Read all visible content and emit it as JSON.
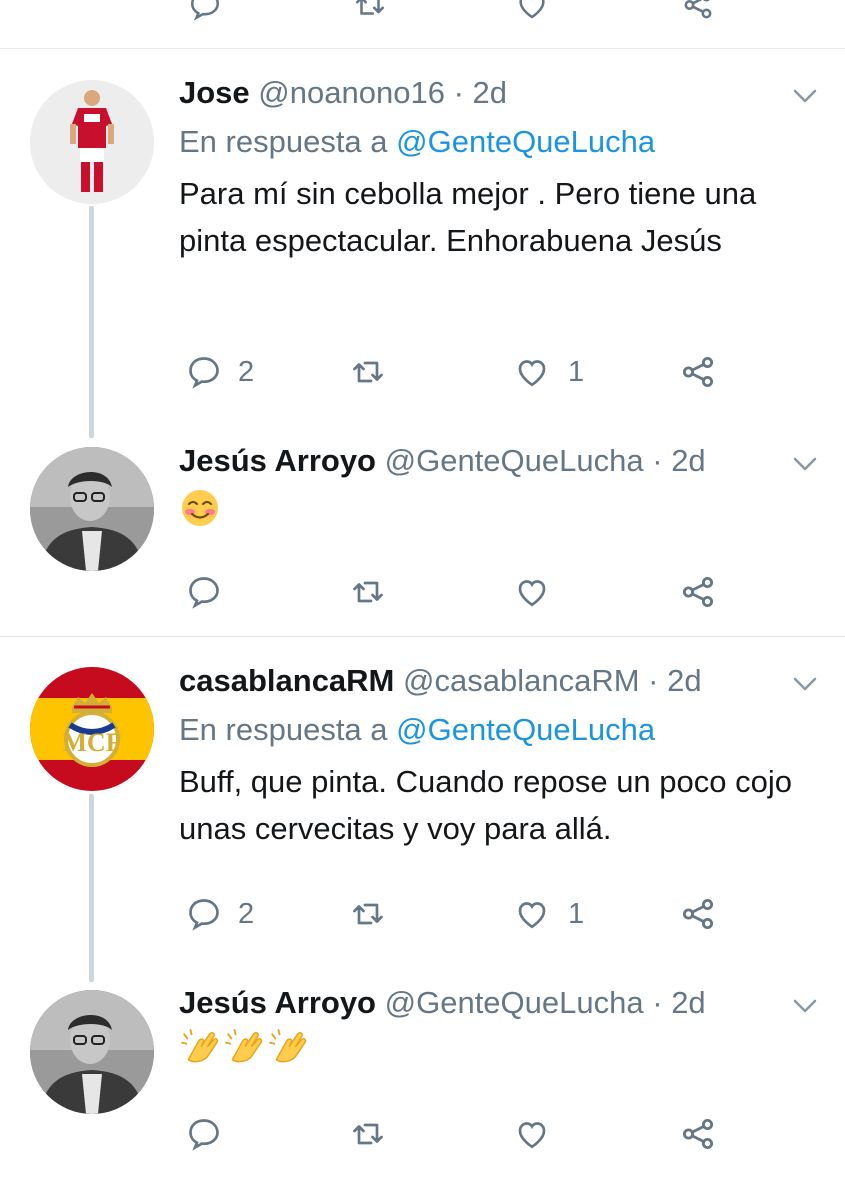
{
  "tweets": [
    {
      "name": "Jose",
      "handle": "@noanono16",
      "separator": "·",
      "time": "2d",
      "reply_prefix": "En respuesta a",
      "reply_handle": "@GenteQueLucha",
      "text": "Para mí sin cebolla mejor . Pero tiene una pinta espectacular. Enhorabuena Jesús",
      "reply_count": "2",
      "retweet_count": "",
      "like_count": "1",
      "avatar": "footballer-in-red-kit"
    },
    {
      "name": "Jesús Arroyo",
      "handle": "@GenteQueLucha",
      "separator": "·",
      "time": "2d",
      "emoji": "smiling-face-with-blush",
      "reply_count": "",
      "retweet_count": "",
      "like_count": "",
      "avatar": "man-with-glasses-bw"
    },
    {
      "name": "casablancaRM",
      "handle": "@casablancaRM",
      "separator": "·",
      "time": "2d",
      "reply_prefix": "En respuesta a",
      "reply_handle": "@GenteQueLucha",
      "text": "Buff, que pinta. Cuando repose un poco cojo unas cervecitas y voy para allá.",
      "reply_count": "2",
      "retweet_count": "",
      "like_count": "1",
      "avatar": "real-madrid-crest-spanish-flag"
    },
    {
      "name": "Jesús Arroyo",
      "handle": "@GenteQueLucha",
      "separator": "·",
      "time": "2d",
      "emoji": "clapping-hands-x3",
      "reply_count": "",
      "retweet_count": "",
      "like_count": "",
      "avatar": "man-with-glasses-bw"
    }
  ],
  "colors": {
    "text": "#14171a",
    "secondary": "#657786",
    "link": "#1b95e0",
    "thread_line": "#ccd6dd",
    "divider": "#e1e8ed"
  }
}
